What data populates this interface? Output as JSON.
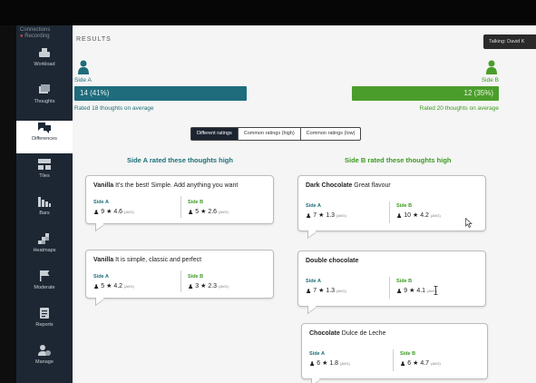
{
  "sidebar": {
    "header_line1": "Connections",
    "header_line2": "Recording",
    "items": [
      {
        "label": "Workload",
        "icon": "workload-icon"
      },
      {
        "label": "Thoughts",
        "icon": "thoughts-icon"
      },
      {
        "label": "Differences",
        "icon": "differences-icon",
        "active": true
      },
      {
        "label": "Tiles",
        "icon": "tiles-icon"
      },
      {
        "label": "Bars",
        "icon": "bars-icon"
      },
      {
        "label": "Heatmaps",
        "icon": "heatmaps-icon"
      },
      {
        "label": "Moderate",
        "icon": "flag-icon"
      },
      {
        "label": "Reports",
        "icon": "reports-icon"
      },
      {
        "label": "Manage",
        "icon": "manage-icon"
      }
    ]
  },
  "header": {
    "title": "RESULTS",
    "talking": "Talking: David K"
  },
  "side_a": {
    "label": "Side A",
    "bar_text": "14 (41%)",
    "bar_fraction": 0.41,
    "avg_text": "Rated 18 thoughts on average",
    "color": "#1f6c7c"
  },
  "side_b": {
    "label": "Side B",
    "bar_text": "12 (35%)",
    "bar_fraction": 0.35,
    "avg_text": "Rated 20 thoughts on average",
    "color": "#4b9d2b"
  },
  "tabs": [
    {
      "label": "Different ratings",
      "active": true
    },
    {
      "label": "Common ratings (high)"
    },
    {
      "label": "Common ratings (low)"
    }
  ],
  "columns": {
    "a_heading": "Side A rated these thoughts high",
    "b_heading": "Side B rated these thoughts high"
  },
  "stat_labels": {
    "a": "Side A",
    "b": "Side B",
    "avg": "(AVG)"
  },
  "cards": [
    {
      "title_bold": "Vanilla",
      "title_rest": " It's the best! Simple. Add anything you want",
      "a_count": "9",
      "a_avg": "4.6",
      "b_count": "5",
      "b_avg": "2.6"
    },
    {
      "title_bold": "Vanilla",
      "title_rest": " It is simple, classic and perfect",
      "a_count": "5",
      "a_avg": "4.2",
      "b_count": "3",
      "b_avg": "2.3"
    },
    {
      "title_bold": "Dark Chocolate",
      "title_rest": " Great flavour",
      "a_count": "7",
      "a_avg": "1.3",
      "b_count": "10",
      "b_avg": "4.2"
    },
    {
      "title_bold": "Double chocolate",
      "title_rest": "",
      "a_count": "7",
      "a_avg": "1.3",
      "b_count": "9",
      "b_avg": "4.1"
    },
    {
      "title_bold": "Chocolate",
      "title_rest": " Dulce de Leche",
      "a_count": "6",
      "a_avg": "1.8",
      "b_count": "6",
      "b_avg": "4.7"
    }
  ]
}
